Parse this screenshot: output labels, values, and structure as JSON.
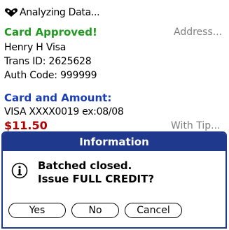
{
  "status": {
    "title": "Analyzing Data...",
    "icon": "handshake-heart-icon"
  },
  "approval": {
    "heading": "Card Approved!",
    "address_link": "Address...",
    "holder": "Henry H Visa",
    "trans_id": "Trans ID:   2625628",
    "auth_code": "Auth Code: 999999"
  },
  "card": {
    "heading": "Card and Amount:",
    "card_line": "VISA XXXX0019 ex:08/08",
    "amount": "$11.50",
    "tip_link": "With Tip..."
  },
  "dialog": {
    "title": "Information",
    "message_line1": "Batched closed.",
    "message_line2": "Issue FULL CREDIT?",
    "buttons": {
      "yes": "Yes",
      "no": "No",
      "cancel": "Cancel"
    }
  },
  "colors": {
    "approved": "#1f9a1f",
    "heading_blue": "#1a3cb4",
    "amount_red": "#b00000",
    "dialog_header": "#1f3a8c",
    "muted_link": "#808080"
  }
}
